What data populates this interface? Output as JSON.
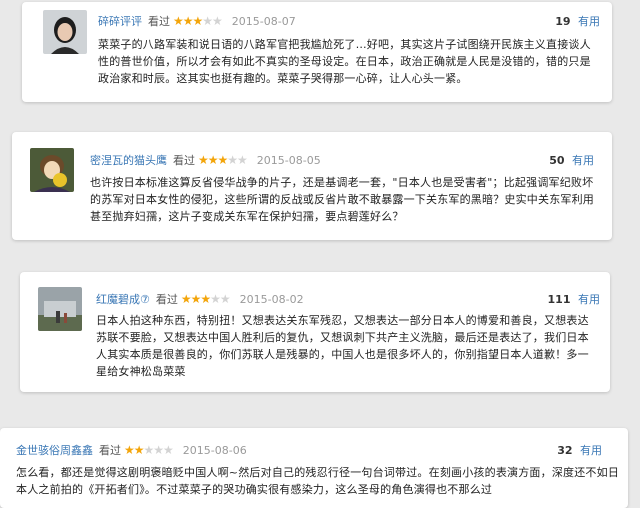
{
  "reviews": [
    {
      "author": "碎碎评评",
      "watched": "看过",
      "rating": 3,
      "date": "2015-08-07",
      "useful_count": "19",
      "useful_label": "有用",
      "text": "菜菜子的八路军装和说日语的八路军官把我尴尬死了…好吧，其实这片子试图绕开民族主义直接谈人性的普世价值，所以才会有如此不真实的圣母设定。在日本，政治正确就是人民是没错的，错的只是政治家和时辰。这其实也挺有趣的。菜菜子哭得那一心碎，让人心头一紧。"
    },
    {
      "author": "密涅瓦的猫头鹰",
      "watched": "看过",
      "rating": 3,
      "date": "2015-08-05",
      "useful_count": "50",
      "useful_label": "有用",
      "text": "也许按日本标准这算反省侵华战争的片子，还是基调老一套，\"日本人也是受害者\"；比起强调军纪败坏的苏军对日本女性的侵犯，这些所谓的反战或反省片敢不敢暴露一下关东军的黑暗？史实中关东军利用甚至抛弃妇孺，这片子变成关东军在保护妇孺，要点碧莲好么？"
    },
    {
      "author": "红魔碧成⑦",
      "watched": "看过",
      "rating": 3,
      "date": "2015-08-02",
      "useful_count": "111",
      "useful_label": "有用",
      "text": "日本人拍这种东西，特别扭！又想表达关东军残忍，又想表达一部分日本人的博爱和善良，又想表达苏联不要脸，又想表达中国人胜利后的复仇，又想讽刺下共产主义洗脑，最后还是表达了，我们日本人其实本质是很善良的，你们苏联人是残暴的，中国人也是很多坏人的，你别指望日本人道歉！多一星给女神松岛菜菜"
    },
    {
      "author": "金世骇俗周鑫鑫",
      "watched": "看过",
      "rating": 2,
      "date": "2015-08-06",
      "useful_count": "32",
      "useful_label": "有用",
      "text": "怎么看，都还是觉得这剧明褒暗贬中国人啊~然后对自己的残忍行径一句台词带过。在刻画小孩的表演方面，深度还不如日本人之前拍的《开拓者们》。不过菜菜子的哭功确实很有感染力，这么圣母的角色演得也不那么过"
    }
  ],
  "colors": {
    "link": "#3a77b5",
    "star_on": "#f3a50b",
    "star_off": "#d3d3d3",
    "background": "#e9e9e9"
  }
}
